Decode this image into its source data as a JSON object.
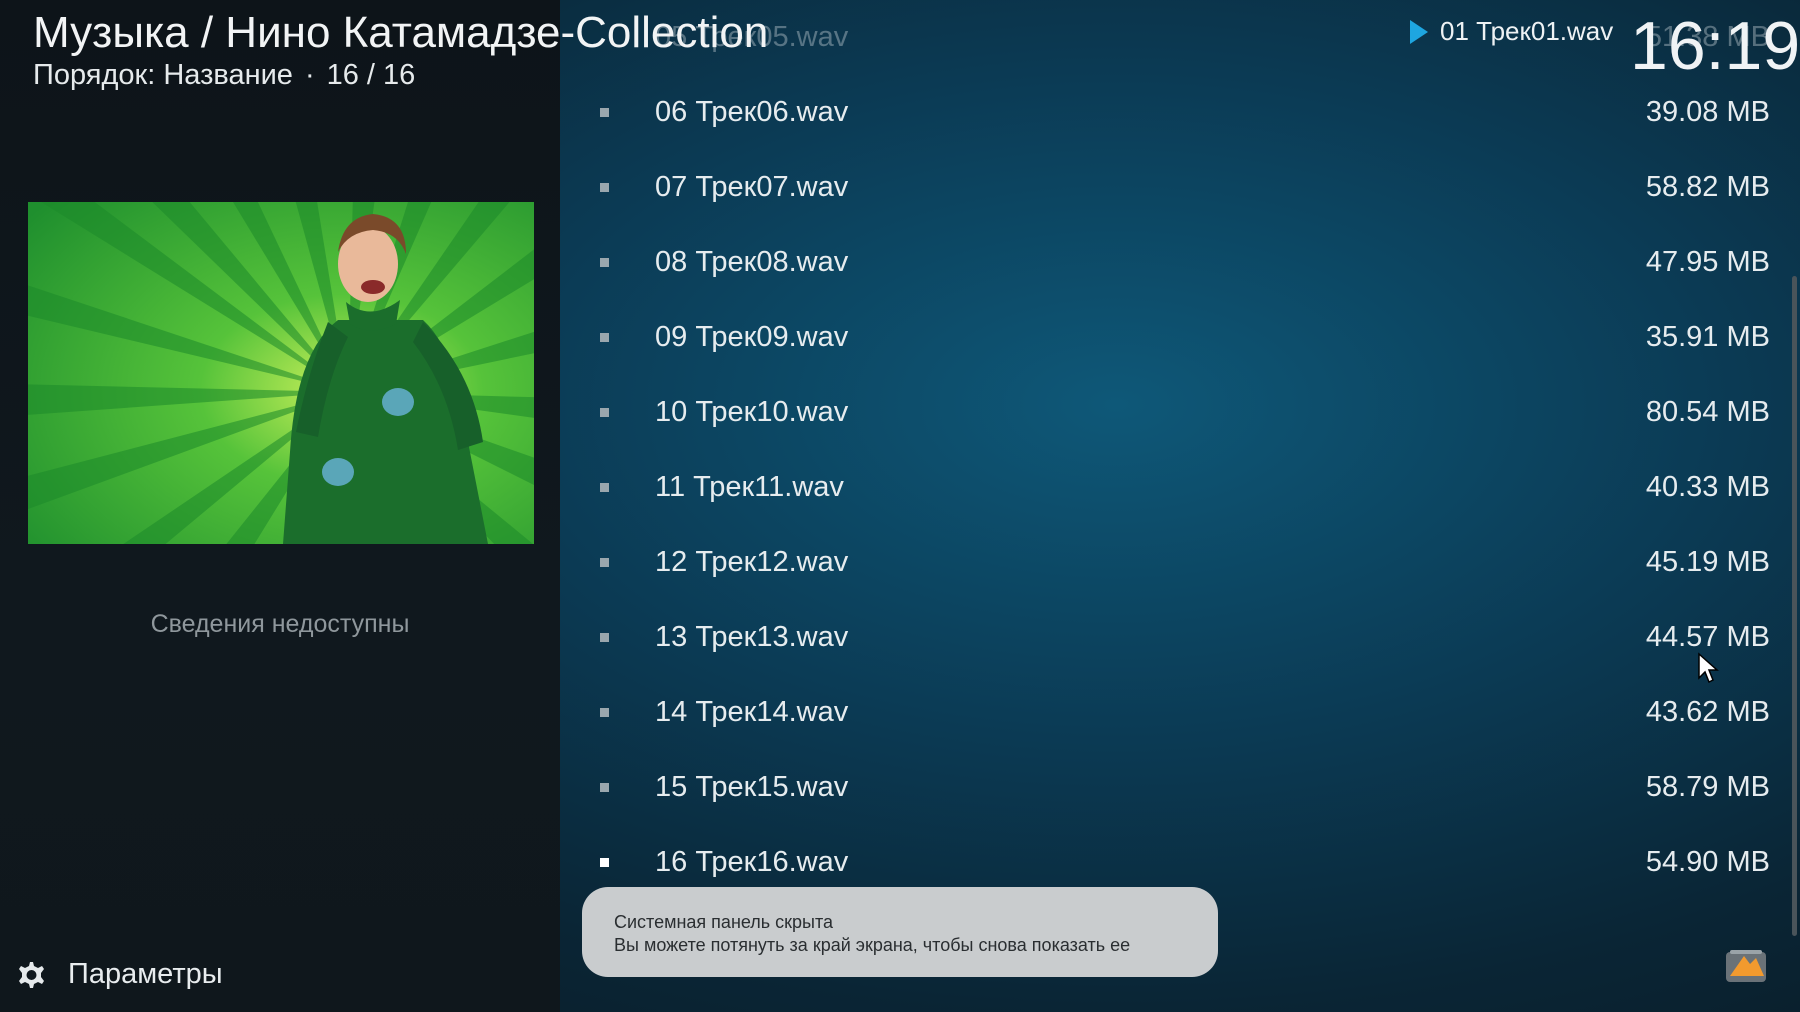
{
  "header": {
    "title": "Музыка / Нино Катамадзе-Collection",
    "sort_label": "Порядок: Название",
    "separator": "·",
    "count": "16 / 16"
  },
  "now_playing": {
    "track": "01 Трек01.wav"
  },
  "clock": "16:19",
  "info_panel": {
    "no_info": "Сведения недоступны"
  },
  "settings": {
    "label": "Параметры"
  },
  "tracks": [
    {
      "title": "05 Трек05.wav",
      "size": "51.38 MB"
    },
    {
      "title": "06 Трек06.wav",
      "size": "39.08 MB"
    },
    {
      "title": "07 Трек07.wav",
      "size": "58.82 MB"
    },
    {
      "title": "08 Трек08.wav",
      "size": "47.95 MB"
    },
    {
      "title": "09 Трек09.wav",
      "size": "35.91 MB"
    },
    {
      "title": "10 Трек10.wav",
      "size": "80.54 MB"
    },
    {
      "title": "11 Трек11.wav",
      "size": "40.33 MB"
    },
    {
      "title": "12 Трек12.wav",
      "size": "45.19 MB"
    },
    {
      "title": "13 Трек13.wav",
      "size": "44.57 MB"
    },
    {
      "title": "14 Трек14.wav",
      "size": "43.62 MB"
    },
    {
      "title": "15 Трек15.wav",
      "size": "58.79 MB"
    },
    {
      "title": "16 Трек16.wav",
      "size": "54.90 MB"
    }
  ],
  "toast": {
    "line1": "Системная панель скрыта",
    "line2": "Вы можете потянуть за край экрана, чтобы снова показать ее"
  },
  "colors": {
    "accent": "#1ea6e0",
    "artwork_green": "#2fa83a"
  }
}
